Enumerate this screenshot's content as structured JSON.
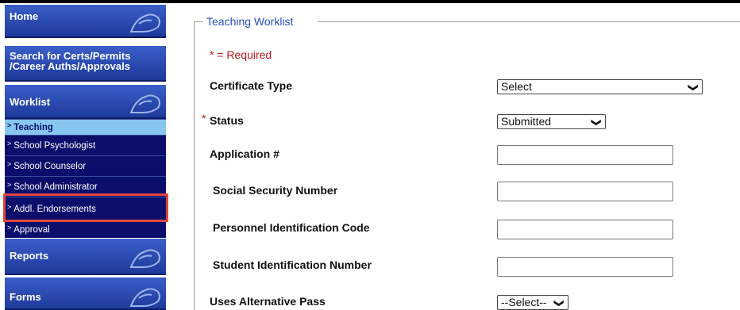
{
  "sidebar": {
    "home": "Home",
    "search_line1": "Search for Certs/Permits",
    "search_line2": "/Career Auths/Approvals",
    "worklist": "Worklist",
    "worklist_items": [
      {
        "label": "Teaching",
        "active": true
      },
      {
        "label": "School Psychologist"
      },
      {
        "label": "School Counselor"
      },
      {
        "label": "School Administrator"
      },
      {
        "label": "Addl. Endorsements"
      },
      {
        "label": "Approval"
      }
    ],
    "reports": "Reports",
    "forms": "Forms",
    "arrow": ">"
  },
  "form": {
    "legend": "Teaching Worklist",
    "required_note": "* = Required",
    "required_star": "*",
    "certificate_type": {
      "label": "Certificate Type",
      "value": "Select"
    },
    "status": {
      "label": "Status",
      "value": "Submitted"
    },
    "application_no": {
      "label": "Application #",
      "value": ""
    },
    "ssn": {
      "label": "Social Security Number",
      "value": ""
    },
    "personnel_code": {
      "label": "Personnel Identification Code",
      "value": ""
    },
    "student_id": {
      "label": "Student Identification Number",
      "value": ""
    },
    "alt_pass": {
      "label": "Uses Alternative Pass",
      "value": "--Select--"
    }
  },
  "colors": {
    "menu": "#2a4bb8",
    "submenu": "#0b0f6b",
    "active": "#86c6ef",
    "required": "#c0161b",
    "legend": "#2b4fbf",
    "highlight": "#e0463c"
  },
  "icons": {
    "dropdown": "chevron-down-icon",
    "menu_decoration": "hand-icon"
  }
}
